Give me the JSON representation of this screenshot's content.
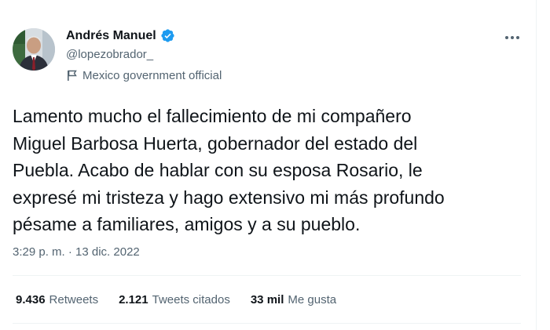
{
  "author": {
    "name": "Andrés Manuel",
    "handle": "@lopezobrador_",
    "label": "Mexico government official",
    "verified": true,
    "verified_color": "#1d9bf0"
  },
  "tweet": {
    "text": "Lamento mucho el fallecimiento de mi compañero\nMiguel Barbosa Huerta, gobernador del estado del\nPuebla. Acabo de hablar con su esposa Rosario, le\nexpresé mi tristeza y hago extensivo mi más profundo\npésame a familiares, amigos y a su pueblo.",
    "timestamp": "3:29 p. m. · 13 dic. 2022"
  },
  "stats": {
    "retweets_count": "9.436",
    "retweets_label": "Retweets",
    "quotes_count": "2.121",
    "quotes_label": "Tweets citados",
    "likes_count": "33 mil",
    "likes_label": "Me gusta"
  },
  "icons": {
    "more": "more-options-icon",
    "verified": "verified-badge-icon",
    "label": "flag-icon"
  }
}
